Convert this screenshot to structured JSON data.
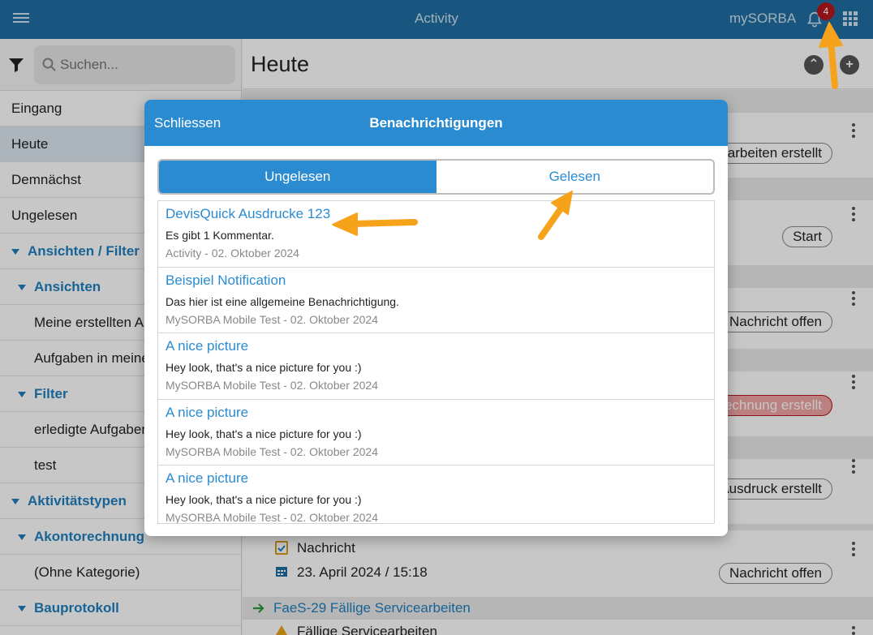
{
  "topbar": {
    "title": "Activity",
    "brand": "mySORBA",
    "notification_count": "4"
  },
  "sidebar": {
    "search_placeholder": "Suchen...",
    "items": [
      {
        "label": "Eingang"
      },
      {
        "label": "Heute"
      },
      {
        "label": "Demnächst"
      },
      {
        "label": "Ungelesen"
      },
      {
        "label": "Ansichten / Filter"
      },
      {
        "label": "Ansichten"
      },
      {
        "label": "Meine erstellten Aufgaben"
      },
      {
        "label": "Aufgaben in meiner Gruppe"
      },
      {
        "label": "Filter"
      },
      {
        "label": "erledigte Aufgaben"
      },
      {
        "label": "test"
      },
      {
        "label": "Aktivitätstypen"
      },
      {
        "label": "Akontorechnung"
      },
      {
        "label": "(Ohne Kategorie)"
      },
      {
        "label": "Bauprotokoll"
      }
    ]
  },
  "main": {
    "title": "Heute",
    "pills": [
      "Servicearbeiten erstellt",
      "Start",
      "Nachricht offen",
      "Rechnung erstellt",
      "Ausdruck erstellt",
      "Nachricht offen"
    ],
    "row_nachricht": "Nachricht",
    "row_date": "23. April 2024 / 15:18",
    "row_link": "FaeS-29  Fällige Servicearbeiten",
    "row_last": "Fällige Servicearbeiten"
  },
  "modal": {
    "close_label": "Schliessen",
    "title": "Benachrichtigungen",
    "tab_unread": "Ungelesen",
    "tab_read": "Gelesen",
    "notifications": [
      {
        "title": "DevisQuick Ausdrucke 123",
        "body": "Es gibt 1 Kommentar.",
        "meta": "Activity - 02. Oktober 2024"
      },
      {
        "title": "Beispiel Notification",
        "body": "Das hier ist eine allgemeine Benachrichtigung.",
        "meta": "MySORBA Mobile Test - 02. Oktober 2024"
      },
      {
        "title": "A nice picture",
        "body": "Hey look, that's a nice picture for you :)",
        "meta": "MySORBA Mobile Test - 02. Oktober 2024"
      },
      {
        "title": "A nice picture",
        "body": "Hey look, that's a nice picture for you :)",
        "meta": "MySORBA Mobile Test - 02. Oktober 2024"
      },
      {
        "title": "A nice picture",
        "body": "Hey look, that's a nice picture for you :)",
        "meta": "MySORBA Mobile Test - 02. Oktober 2024"
      }
    ]
  },
  "colors": {
    "topbar": "#1f6fa3",
    "modal_header": "#2a8bd0",
    "accent": "#1f7fbf",
    "badge": "#b5161d",
    "arrow": "#f7a21b"
  }
}
